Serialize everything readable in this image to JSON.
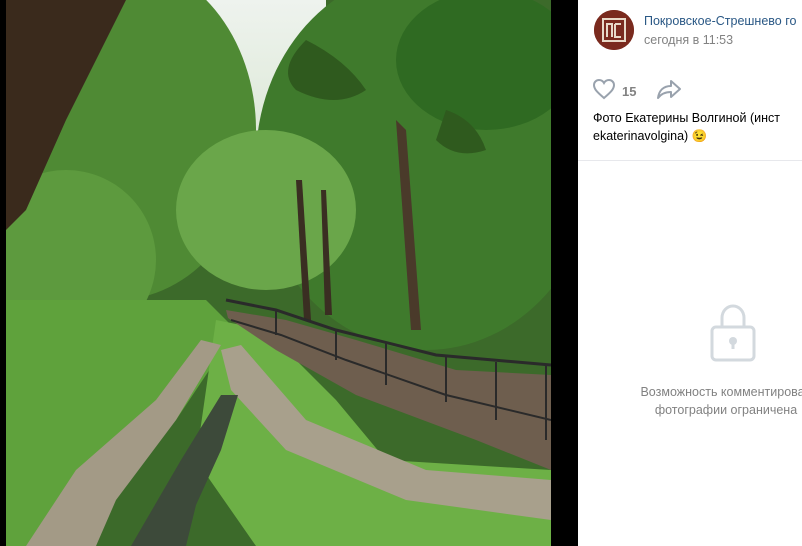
{
  "post": {
    "group_name": "Покровское-Стрешнево го",
    "time": "сегодня в 11:53",
    "likes": "15",
    "caption": "Фото Екатерины Волгиной (инст\nekaterinavolgina) 😉"
  },
  "comments": {
    "restricted_text": "Возможность комментирован\nфотографии ограничена"
  },
  "icons": [
    "heart-icon",
    "share-icon",
    "lock-icon"
  ],
  "colors": {
    "link": "#2a5885",
    "muted": "#828282",
    "panel_bg": "#ffffff",
    "viewer_bg": "#000000"
  }
}
